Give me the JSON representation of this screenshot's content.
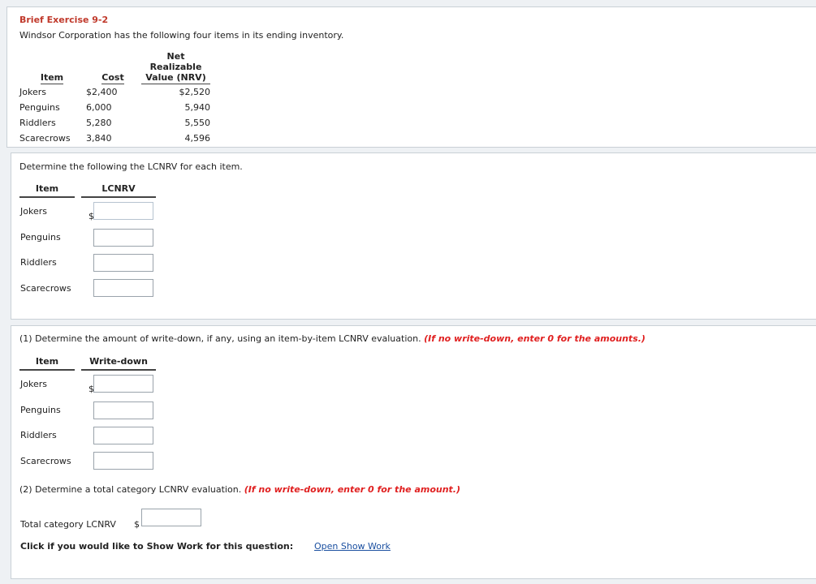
{
  "exercise": {
    "title": "Brief Exercise 9-2",
    "subtitle": "Windsor Corporation has the following four items in its ending inventory."
  },
  "inventory_table": {
    "headers": {
      "item": "Item",
      "cost": "Cost",
      "nrv_line1": "Net Realizable",
      "nrv_line2": "Value (NRV)"
    },
    "rows": [
      {
        "item": "Jokers",
        "cost": "$2,400",
        "nrv": "$2,520"
      },
      {
        "item": "Penguins",
        "cost": "6,000",
        "nrv": "5,940"
      },
      {
        "item": "Riddlers",
        "cost": "5,280",
        "nrv": "5,550"
      },
      {
        "item": "Scarecrows",
        "cost": "3,840",
        "nrv": "4,596"
      }
    ]
  },
  "lcnrv_section": {
    "instruction": "Determine the following the LCNRV for each item.",
    "header_item": "Item",
    "header_value": "LCNRV",
    "currency": "$",
    "rows": [
      {
        "label": "Jokers",
        "value": ""
      },
      {
        "label": "Penguins",
        "value": ""
      },
      {
        "label": "Riddlers",
        "value": ""
      },
      {
        "label": "Scarecrows",
        "value": ""
      }
    ]
  },
  "writedown_section": {
    "instruction": "(1) Determine the amount of write-down, if any, using an item-by-item LCNRV evaluation.",
    "hint": "(If no write-down, enter 0 for the amounts.)",
    "header_item": "Item",
    "header_value": "Write-down",
    "currency": "$",
    "rows": [
      {
        "label": "Jokers",
        "value": ""
      },
      {
        "label": "Penguins",
        "value": ""
      },
      {
        "label": "Riddlers",
        "value": ""
      },
      {
        "label": "Scarecrows",
        "value": ""
      }
    ]
  },
  "category_section": {
    "instruction": "(2) Determine a total category LCNRV evaluation.",
    "hint": "(If no write-down, enter 0 for the amount.)",
    "total_label": "Total category LCNRV",
    "currency": "$",
    "total_value": ""
  },
  "show_work": {
    "prompt": "Click if you would like to Show Work for this question:",
    "link_label": "Open Show Work"
  },
  "colors": {
    "title": "#c0392b",
    "hint": "#e02020",
    "link": "#1a4fa0"
  }
}
